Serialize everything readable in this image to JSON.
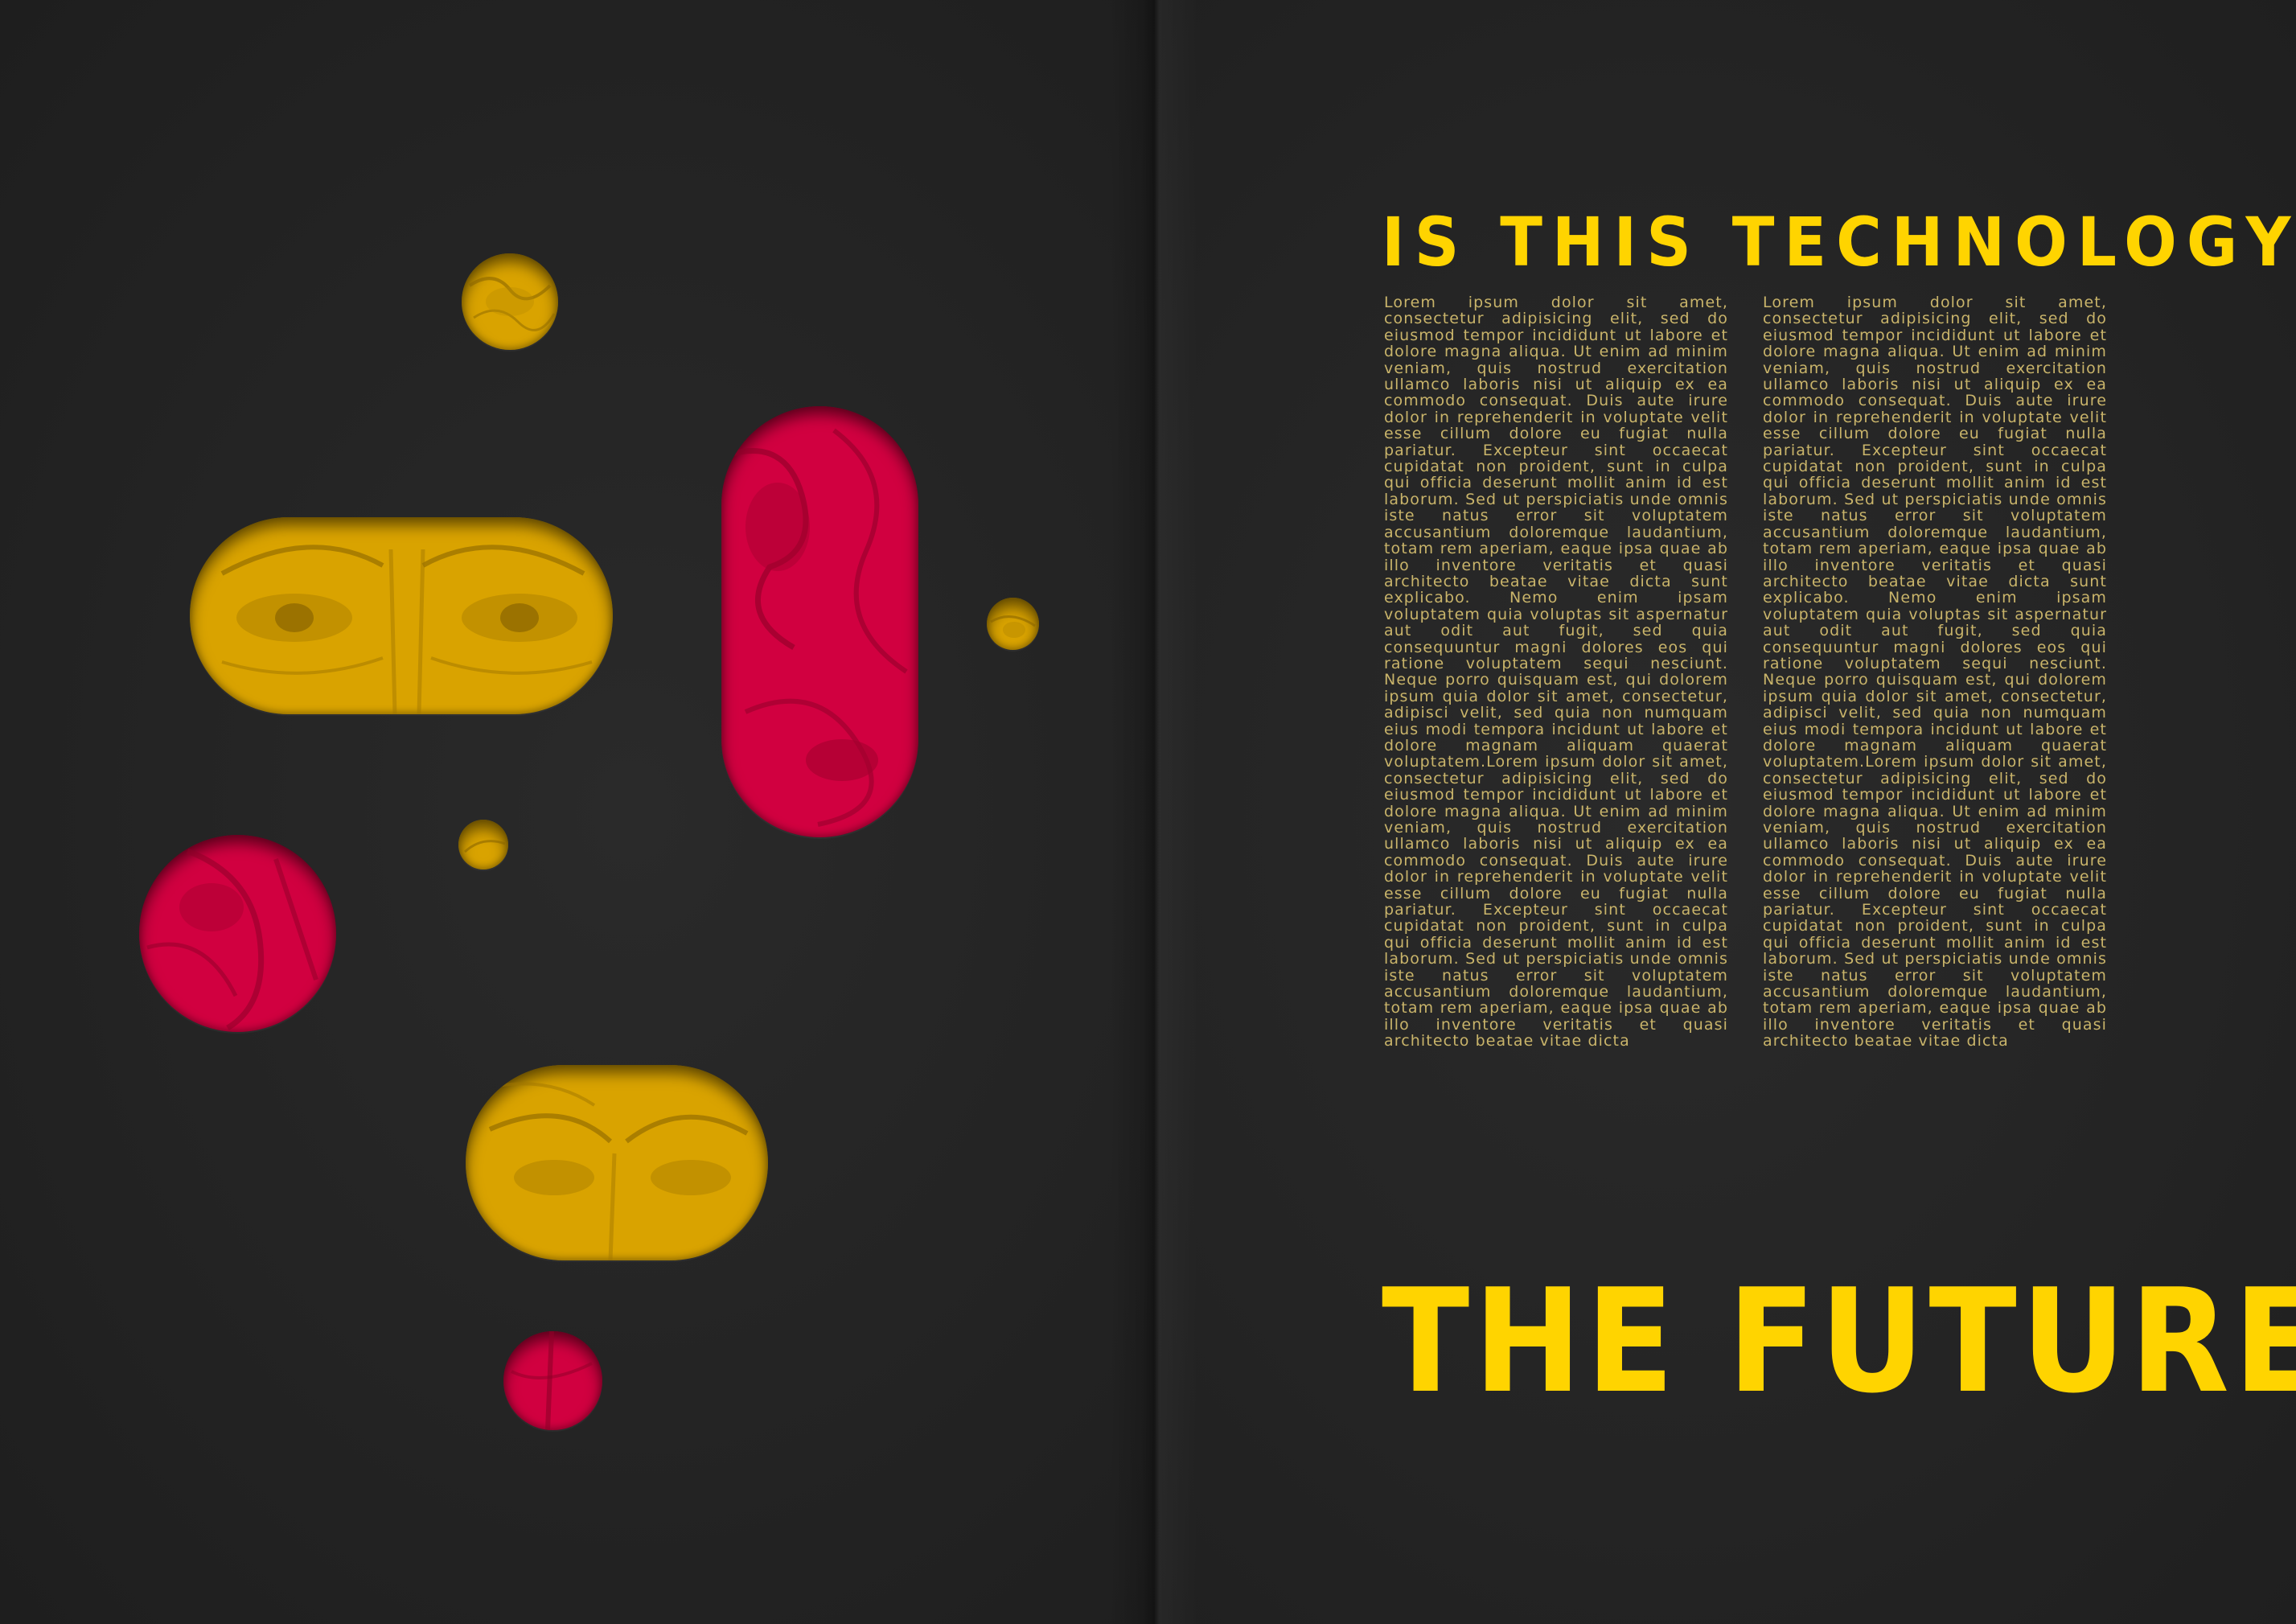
{
  "spread": {
    "colors": {
      "background": "#232323",
      "heading": "#ffd400",
      "body_text": "#c9b46a",
      "shape_yellow": "#d9a300",
      "shape_red": "#d10040"
    },
    "heading_top": "IS THIS TECHNOLOGY",
    "heading_bottom": "THE FUTURE?",
    "columns": [
      "Lorem ipsum dolor sit amet, consectetur adipisicing elit, sed do eiusmod tempor incididunt ut labore et dolore magna aliqua. Ut enim ad minim veniam, quis nostrud exercitation ullamco laboris nisi ut aliquip ex ea commodo consequat. Duis aute irure dolor in reprehenderit in voluptate velit esse cillum dolore eu fugiat nulla pariatur. Excepteur sint occaecat cupidatat non proident, sunt in culpa qui officia deserunt mollit anim id est laborum. Sed ut perspiciatis unde omnis iste natus error sit voluptatem accusantium doloremque laudantium, totam rem aperiam, eaque ipsa quae ab illo inventore veritatis et quasi architecto beatae vitae dicta sunt explicabo. Nemo enim ipsam voluptatem quia voluptas sit aspernatur aut odit aut fugit, sed quia consequuntur magni dolores eos qui ratione voluptatem sequi nesciunt. Neque porro quisquam est, qui dolorem ipsum quia dolor sit amet, consectetur, adipisci velit, sed quia non numquam eius modi tempora incidunt ut labore et dolore magnam aliquam quaerat voluptatem.Lorem ipsum dolor sit amet, consectetur adipisicing elit, sed do eiusmod tempor incididunt ut labore et dolore magna aliqua. Ut enim ad minim veniam, quis nostrud exercitation ullamco laboris nisi ut aliquip ex ea commodo consequat. Duis aute irure dolor in reprehenderit in voluptate velit esse cillum dolore eu fugiat nulla pariatur. Excepteur sint occaecat cupidatat non proident, sunt in culpa qui officia deserunt mollit anim id est laborum. Sed ut perspiciatis unde omnis iste natus error sit voluptatem accusantium doloremque laudantium, totam rem aperiam, eaque ipsa quae ab illo inventore veritatis et quasi architecto beatae vitae dicta",
      "Lorem ipsum dolor sit amet, consectetur adipisicing elit, sed do eiusmod tempor incididunt ut labore et dolore magna aliqua. Ut enim ad minim veniam, quis nostrud exercitation ullamco laboris nisi ut aliquip ex ea commodo consequat. Duis aute irure dolor in reprehenderit in voluptate velit esse cillum dolore eu fugiat nulla pariatur. Excepteur sint occaecat cupidatat non proident, sunt in culpa qui officia deserunt mollit anim id est laborum. Sed ut perspiciatis unde omnis iste natus error sit voluptatem accusantium doloremque laudantium, totam rem aperiam, eaque ipsa quae ab illo inventore veritatis et quasi architecto beatae vitae dicta sunt explicabo. Nemo enim ipsam voluptatem quia voluptas sit aspernatur aut odit aut fugit, sed quia consequuntur magni dolores eos qui ratione voluptatem sequi nesciunt. Neque porro quisquam est, qui dolorem ipsum quia dolor sit amet, consectetur, adipisci velit, sed quia non numquam eius modi tempora incidunt ut labore et dolore magnam aliquam quaerat voluptatem.Lorem ipsum dolor sit amet, consectetur adipisicing elit, sed do eiusmod tempor incididunt ut labore et dolore magna aliqua. Ut enim ad minim veniam, quis nostrud exercitation ullamco laboris nisi ut aliquip ex ea commodo consequat. Duis aute irure dolor in reprehenderit in voluptate velit esse cillum dolore eu fugiat nulla pariatur. Excepteur sint occaecat cupidatat non proident, sunt in culpa qui officia deserunt mollit anim id est laborum. Sed ut perspiciatis unde omnis iste natus error sit voluptatem accusantium doloremque laudantium, totam rem aperiam, eaque ipsa quae ab illo inventore veritatis et quasi architecto beatae vitae dicta"
    ]
  }
}
